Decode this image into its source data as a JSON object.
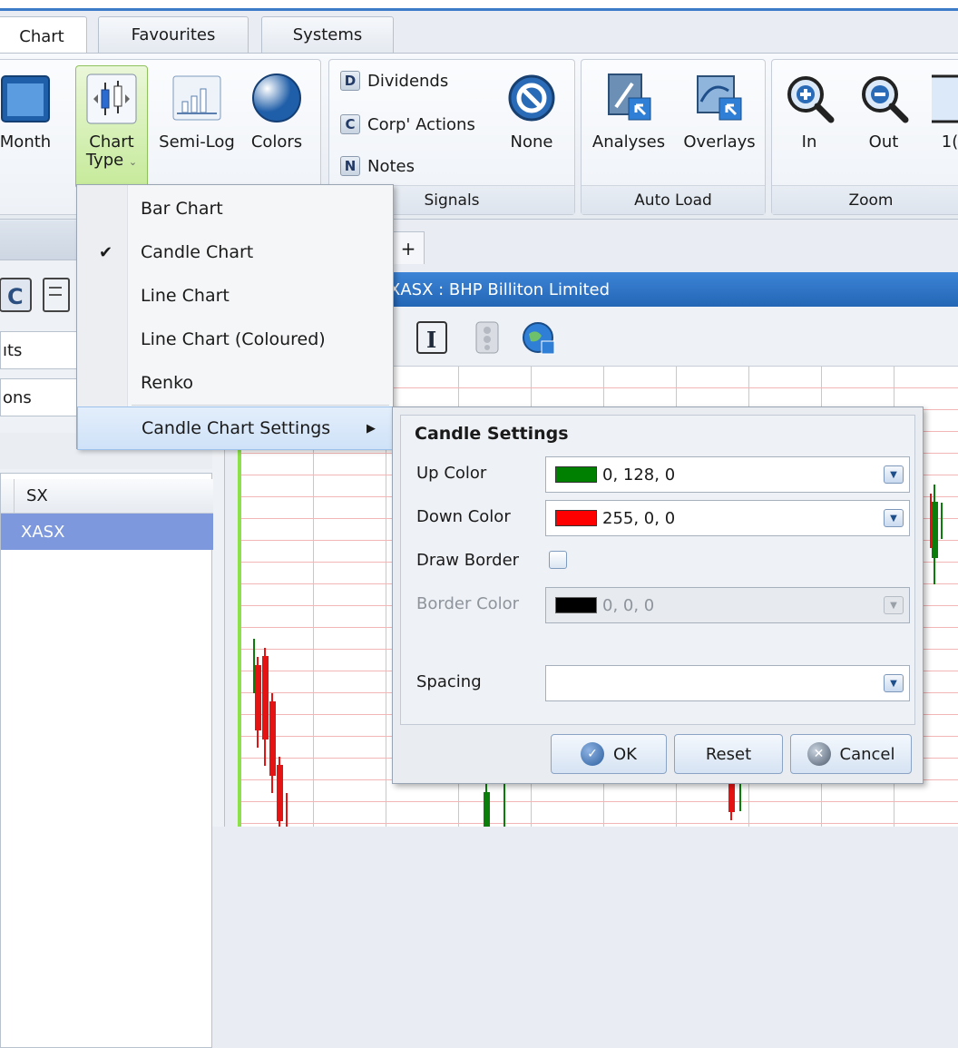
{
  "tabs": [
    "Chart",
    "Favourites",
    "Systems"
  ],
  "ribbon": {
    "month_label": "Month",
    "chart_type_label": "Chart",
    "chart_type_label2": "Type",
    "semilog_label": "Semi-Log",
    "colors_label": "Colors",
    "signals": {
      "dividends": "Dividends",
      "corp_actions": "Corp' Actions",
      "notes": "Notes",
      "none": "None",
      "group_label": "Signals",
      "badge_d": "D",
      "badge_c": "C",
      "badge_n": "N"
    },
    "autoload": {
      "analyses": "Analyses",
      "overlays": "Overlays",
      "group_label": "Auto Load"
    },
    "zoom": {
      "in": "In",
      "out": "Out",
      "more": "1(",
      "group_label": "Zoom"
    }
  },
  "left_panel": {
    "row1": "ıts",
    "row2": "ons",
    "col_header": "SX",
    "selected_item": "XASX"
  },
  "chart": {
    "tab_plus": "+",
    "title": "XASX : BHP Billiton Limited",
    "up_color": "#0a7d0a",
    "down_color": "#e41414"
  },
  "menu": {
    "items": [
      "Bar Chart",
      "Candle Chart",
      "Line Chart",
      "Line Chart (Coloured)",
      "Renko",
      "Candle Chart Settings"
    ],
    "checked": "Candle Chart",
    "check_mark": "✔",
    "submenu_arrow": "▶"
  },
  "settings": {
    "title": "Candle Settings",
    "up_color_label": "Up Color",
    "up_color_value": "0, 128, 0",
    "up_color_hex": "#008000",
    "down_color_label": "Down Color",
    "down_color_value": "255, 0, 0",
    "down_color_hex": "#ff0000",
    "draw_border_label": "Draw Border",
    "draw_border_checked": false,
    "border_color_label": "Border Color",
    "border_color_value": "0, 0, 0",
    "border_color_hex": "#000000",
    "spacing_label": "Spacing",
    "spacing_value": "",
    "ok_label": "OK",
    "reset_label": "Reset",
    "cancel_label": "Cancel"
  }
}
